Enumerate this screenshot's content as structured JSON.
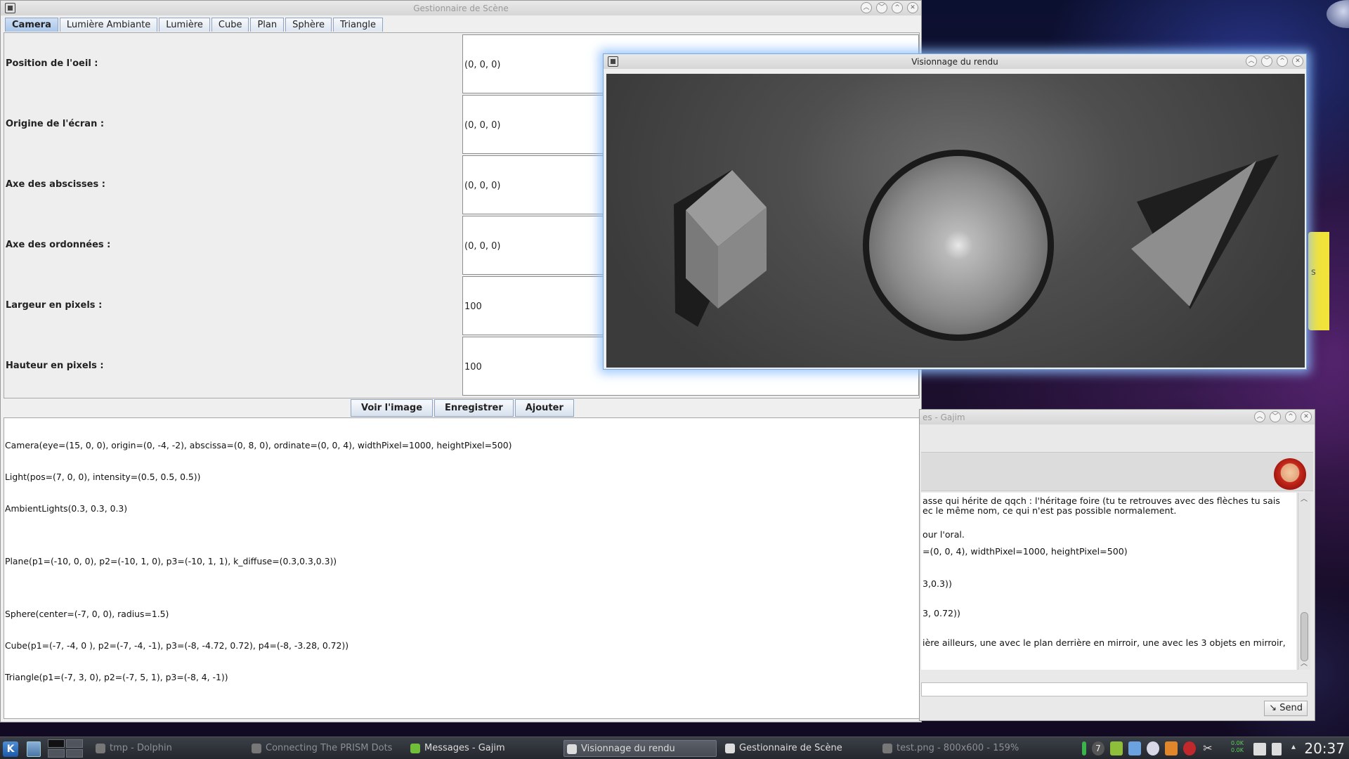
{
  "scene_manager": {
    "title": "Gestionnaire de Scène",
    "tabs": [
      "Camera",
      "Lumière Ambiante",
      "Lumière",
      "Cube",
      "Plan",
      "Sphère",
      "Triangle"
    ],
    "selected_tab": "Camera",
    "fields": [
      {
        "label": "Position de l'oeil :",
        "value": "(0, 0, 0)"
      },
      {
        "label": "Origine de l'écran :",
        "value": "(0, 0, 0)"
      },
      {
        "label": "Axe des abscisses :",
        "value": "(0, 0, 0)"
      },
      {
        "label": "Axe des ordonnées :",
        "value": "(0, 0, 0)"
      },
      {
        "label": "Largeur en pixels :",
        "value": "100"
      },
      {
        "label": "Hauteur en pixels :",
        "value": "100"
      }
    ],
    "buttons": {
      "view": "Voir l'image",
      "save": "Enregistrer",
      "add": "Ajouter"
    },
    "scene_text": [
      "Camera(eye=(15, 0, 0), origin=(0, -4, -2), abscissa=(0, 8, 0), ordinate=(0, 0, 4), widthPixel=1000, heightPixel=500)",
      "Light(pos=(7, 0, 0), intensity=(0.5, 0.5, 0.5))",
      "AmbientLights(0.3, 0.3, 0.3)",
      "",
      "Plane(p1=(-10, 0, 0), p2=(-10, 1, 0), p3=(-10, 1, 1), k_diffuse=(0.3,0.3,0.3))",
      "",
      "Sphere(center=(-7, 0, 0), radius=1.5)",
      "Cube(p1=(-7, -4, 0 ), p2=(-7, -4, -1), p3=(-8, -4.72, 0.72), p4=(-8, -3.28, 0.72))",
      "Triangle(p1=(-7, 3, 0), p2=(-7, 5, 1), p3=(-8, 4, -1))"
    ]
  },
  "render_window": {
    "title": "Visionnage du rendu"
  },
  "gajim": {
    "title": "es - Gajim",
    "messages": [
      "asse qui hérite de qqch : l'héritage foire (tu te retrouves avec des flèches tu sais",
      "ec le même nom, ce qui n'est pas possible normalement.",
      "our l'oral.",
      "=(0, 0, 4), widthPixel=1000, heightPixel=500)",
      "3,0.3))",
      "3, 0.72))",
      "ière ailleurs, une avec le plan derrière en mirroir, une avec les 3 objets en mirroir,"
    ],
    "send_label": "Send"
  },
  "desktop": {
    "sticky_text": "s"
  },
  "taskbar": {
    "tasks": [
      {
        "label": "tmp - Dolphin",
        "state": "dim"
      },
      {
        "label": "Connecting The PRISM Dots",
        "state": "dim"
      },
      {
        "label": "Messages - Gajim",
        "state": "normal"
      },
      {
        "label": "Visionnage du rendu",
        "state": "active"
      },
      {
        "label": "Gestionnaire de Scène",
        "state": "normal"
      },
      {
        "label": "test.png - 800x600 - 159%",
        "state": "dim"
      }
    ],
    "tray_badge": "7",
    "net_up": "0.0K",
    "net_down": "0.0K",
    "clock": "20:37"
  },
  "colors": {
    "tab_border": "#8ea4c2",
    "render_glow": "#8cbeff",
    "net_green": "#5ccf5c"
  }
}
